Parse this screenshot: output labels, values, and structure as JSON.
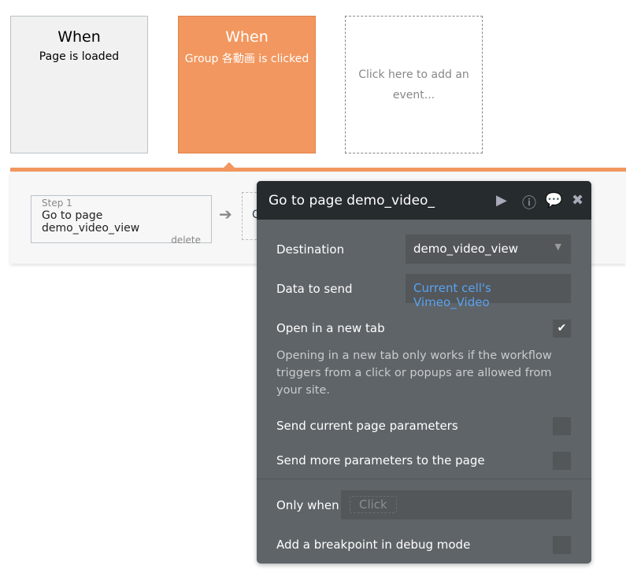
{
  "events": [
    {
      "when": "When",
      "trigger": "Page is loaded"
    },
    {
      "when": "When",
      "trigger": "Group 各動画 is clicked"
    },
    {
      "add": "Click here to add an event..."
    }
  ],
  "steps": [
    {
      "label": "Step 1",
      "action": "Go to page demo_video_view",
      "delete": "delete"
    },
    {
      "partial": "C"
    }
  ],
  "editor": {
    "title": "Go to page demo_video_",
    "destination_label": "Destination",
    "destination_value": "demo_video_view",
    "data_label": "Data to send",
    "data_value": "Current cell's Vimeo_Video",
    "newtab_label": "Open in a new tab",
    "newtab_checked": true,
    "help": "Opening in a new tab only works if the workflow triggers from a click or popups are allowed from your site.",
    "send_params_label": "Send current page parameters",
    "more_params_label": "Send more parameters to the page",
    "only_when_label": "Only when",
    "only_when_placeholder": "Click",
    "breakpoint_label": "Add a breakpoint in debug mode",
    "accent": "#f2975f",
    "link_color": "#5aa2f0"
  }
}
